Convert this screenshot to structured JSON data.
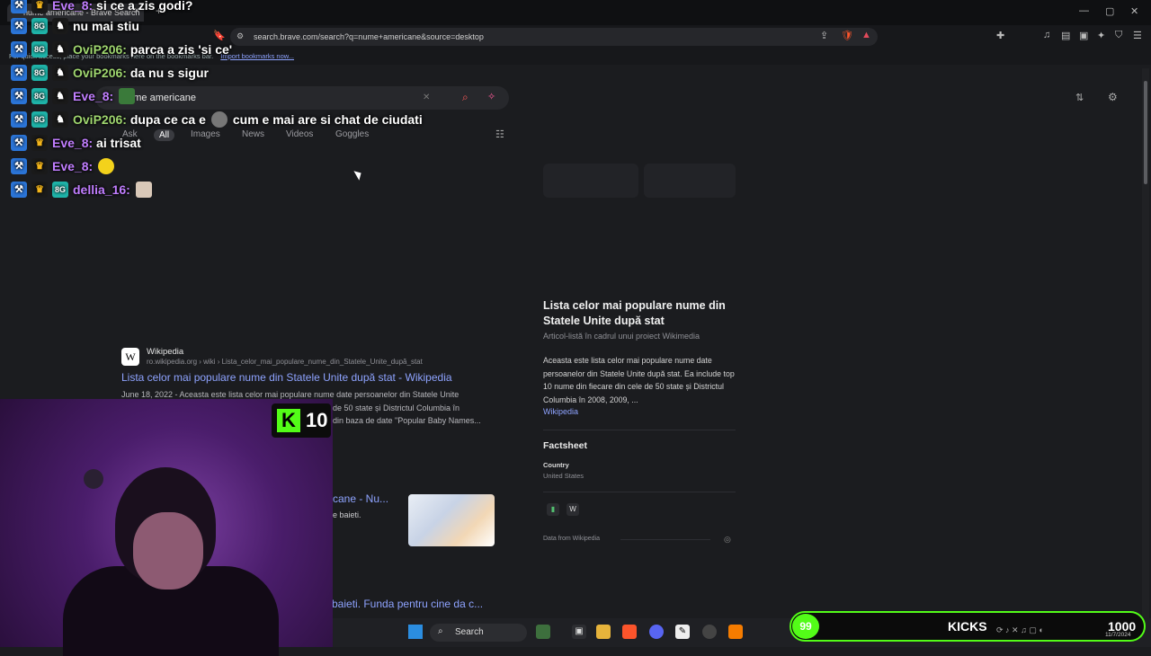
{
  "browser": {
    "tab_title": "nume americane - Brave Search",
    "url": "search.brave.com/search?q=nume+americane&source=desktop",
    "bookmarks_hint": "For quick access, place your bookmarks here on the bookmarks bar.",
    "bookmarks_import": "Import bookmarks now..."
  },
  "search": {
    "query": "nume americane",
    "tabs": [
      "Ask",
      "All",
      "Images",
      "News",
      "Videos",
      "Goggles"
    ]
  },
  "infobox": {
    "title": "Lista celor mai populare nume din Statele Unite după stat",
    "subtitle": "Articol-listă în cadrul unui proiect Wikimedia",
    "description": "Aceasta este lista celor mai populare nume date persoanelor din Statele Unite după stat. Ea include top 10 nume din fiecare din cele de 50 state și Districtul Columbia în 2008, 2009, ...",
    "source_link": "Wikipedia",
    "factsheet_heading": "Factsheet",
    "country_label": "Country",
    "country_value": "United States",
    "data_from": "Data from Wikipedia"
  },
  "results": [
    {
      "site": "Wikipedia",
      "url": "ro.wikipedia.org › wiki › Lista_celor_mai_populare_nume_din_Statele_Unite_după_stat",
      "title": "Lista celor mai populare nume din Statele Unite după stat - Wikipedia",
      "snippet_line1": "June 18, 2022 - Aceasta este lista celor mai populare nume date persoanelor din Statele Unite",
      "snippet_line2": "de 50 state și Districtul Columbia în",
      "snippet_line3": "din baza de date \"Popular Baby Names..."
    },
    {
      "title": "cane - Nu...",
      "snippet": "e baieti."
    },
    {
      "title": "baieti. Funda pentru cine da c..."
    }
  ],
  "chat": [
    {
      "user": "Eve_8:",
      "message": "si ce a zis godi?",
      "color": "#c17eff"
    },
    {
      "user": "nu mai stiu",
      "message": "",
      "color": "#ffffff"
    },
    {
      "user": "OviP206:",
      "message": "parca a zis 'si ce'",
      "color": "#9fd66f"
    },
    {
      "user": "OviP206:",
      "message": "da nu s sigur",
      "color": "#9fd66f"
    },
    {
      "user": "Eve_8:",
      "message": "",
      "color": "#c17eff"
    },
    {
      "user": "OviP206:",
      "message": "dupa ce ca e",
      "message2": "cum e mai are si chat de ciudati",
      "color": "#9fd66f"
    },
    {
      "user": "Eve_8:",
      "message": "ai trisat",
      "color": "#c17eff"
    },
    {
      "user": "Eve_8:",
      "message": "",
      "color": "#c17eff"
    },
    {
      "user": "dellia_16:",
      "message": "",
      "color": "#c17eff"
    }
  ],
  "overlay": {
    "kick_level": "10",
    "kicks_count": "99",
    "kicks_label": "KICKS",
    "kicks_goal": "1000",
    "clock": "11/7/2024"
  },
  "taskbar": {
    "search_label": "Search"
  },
  "colors": {
    "kick_green": "#53fc18",
    "link_blue": "#8ea3ff",
    "page_bg": "#1b1c1f"
  }
}
